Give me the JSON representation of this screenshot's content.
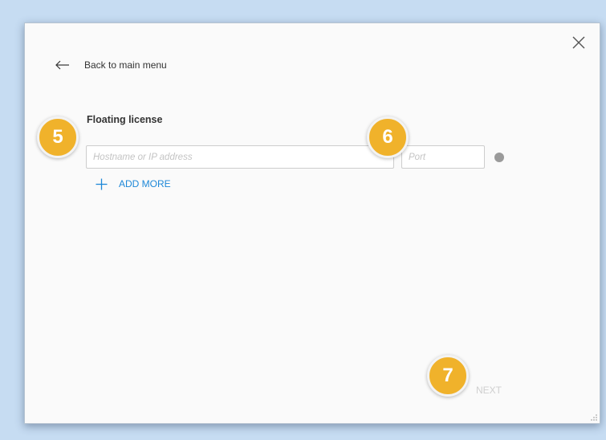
{
  "header": {
    "back_label": "Back to main menu",
    "close_icon": "close-icon",
    "back_icon": "arrow-left-icon"
  },
  "license": {
    "section_title": "Floating license",
    "host_placeholder": "Hostname or IP address",
    "host_value": "",
    "port_placeholder": "Port",
    "port_value": "",
    "status_color": "#9a9a9a",
    "add_more_label": "ADD MORE",
    "add_icon": "plus-icon"
  },
  "footer": {
    "next_label": "NEXT"
  },
  "annotations": {
    "badge_5": "5",
    "badge_6": "6",
    "badge_7": "7",
    "badge_color": "#f0b22b"
  },
  "colors": {
    "accent": "#1e88d8",
    "background": "#c6dcf2",
    "dialog_bg": "#fafafa"
  }
}
